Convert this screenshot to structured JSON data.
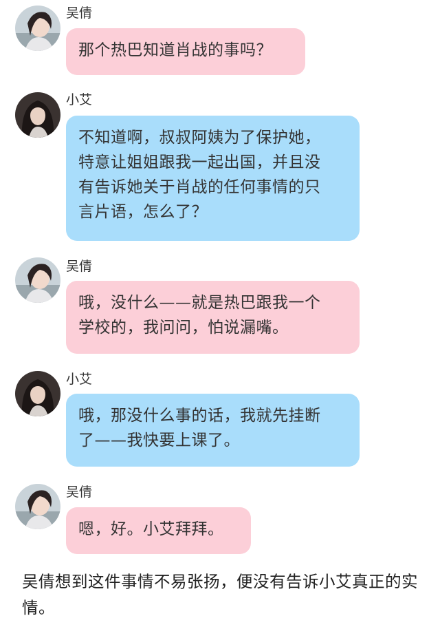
{
  "colors": {
    "bubble_pink": "#fccfd8",
    "bubble_blue": "#a9ddfb"
  },
  "messages": [
    {
      "sender": "吴倩",
      "avatar_icon": "avatar-wuqian-icon",
      "text": "那个热巴知道肖战的事吗？",
      "bubble": "pink"
    },
    {
      "sender": "小艾",
      "avatar_icon": "avatar-xiaoai-icon",
      "text": "不知道啊，叔叔阿姨为了保护她，\n特意让姐姐跟我一起出国，并且没\n有告诉她关于肖战的任何事情的只\n言片语，怎么了？",
      "bubble": "blue"
    },
    {
      "sender": "吴倩",
      "avatar_icon": "avatar-wuqian-icon",
      "text": "哦，没什么——就是热巴跟我一个\n学校的，我问问，怕说漏嘴。",
      "bubble": "pink"
    },
    {
      "sender": "小艾",
      "avatar_icon": "avatar-xiaoai-icon",
      "text": "哦，那没什么事的话，我就先挂断\n了——我快要上课了。",
      "bubble": "blue"
    },
    {
      "sender": "吴倩",
      "avatar_icon": "avatar-wuqian-icon",
      "text": "嗯，好。小艾拜拜。",
      "bubble": "pink"
    }
  ],
  "narration": "吴倩想到这件事情不易张扬，便没有告诉小艾真正的实情。"
}
